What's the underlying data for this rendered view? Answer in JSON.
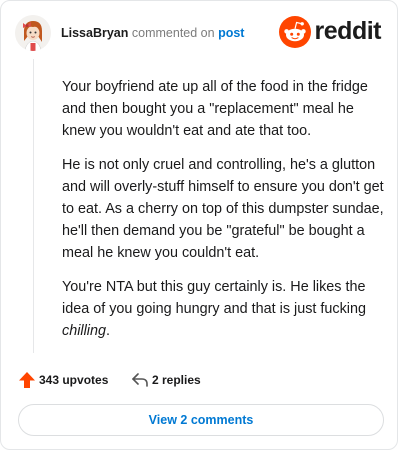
{
  "comment": {
    "author": "LissaBryan",
    "commented_on_text": "commented on",
    "post_label": "post",
    "brand_name": "reddit",
    "paragraphs": [
      "Your boyfriend ate up all of the food in the fridge and then bought you a \"replacement\" meal he knew you wouldn't eat and ate that too.",
      "He is not only cruel and controlling, he's a glutton and will overly-stuff himself to ensure you don't get to eat. As a cherry on top of this dumpster sundae, he'll then demand you be \"grateful\" be bought a meal he knew you couldn't eat."
    ],
    "last_paragraph": {
      "text": "You're NTA but this guy certainly is. He likes the idea of you going hungry and that is just fucking ",
      "emphasis": "chilling",
      "end": "."
    },
    "upvotes": "343 upvotes",
    "replies": "2 replies",
    "view_comments_label": "View 2 comments"
  },
  "colors": {
    "brand_orange": "#ff4500",
    "link_blue": "#0079d3",
    "text_dark": "#1a1a1b",
    "meta_gray": "#7c7c7c"
  },
  "icons": {
    "avatar": "user-avatar",
    "logo": "reddit-logo-icon",
    "upvote": "upvote-arrow-icon",
    "reply": "reply-arrow-icon"
  }
}
